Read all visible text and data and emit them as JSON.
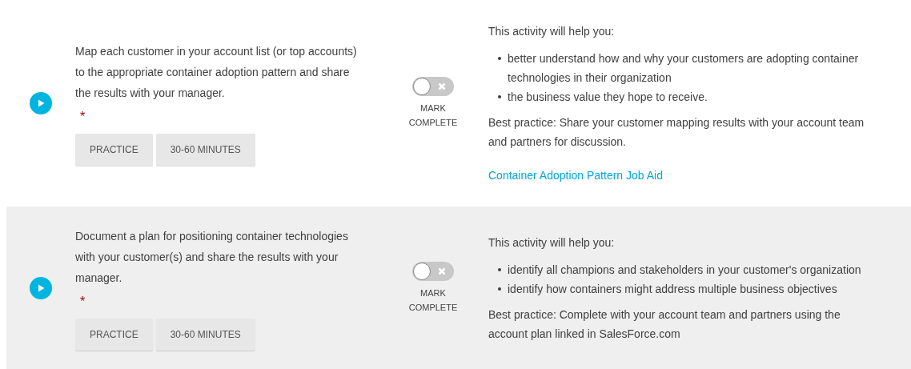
{
  "activities": [
    {
      "shaded": false,
      "description": "Map each customer in your account list (or top accounts) to the appropriate container adoption pattern and share the results with your manager.",
      "required_mark": "*",
      "tags": [
        "PRACTICE",
        "30-60 MINUTES"
      ],
      "toggle": {
        "checked": false,
        "label": "MARK COMPLETE"
      },
      "intro": "This activity will help you:",
      "bullets": [
        "better understand how and why your customers are adopting container technologies in their organization",
        "the business value they hope to receive."
      ],
      "best_practice": "Best practice: Share your customer mapping results with your account team and partners for discussion.",
      "link": "Container Adoption Pattern Job Aid"
    },
    {
      "shaded": true,
      "description": "Document a plan for positioning container technologies with your customer(s) and share the results with your manager.",
      "required_mark": "*",
      "tags": [
        "PRACTICE",
        "30-60 MINUTES"
      ],
      "toggle": {
        "checked": false,
        "label": "MARK COMPLETE"
      },
      "intro": "This activity will help you:",
      "bullets": [
        "identify all champions and stakeholders in your customer's organization",
        "identify how containers might address multiple business objectives"
      ],
      "best_practice": "Best practice: Complete with your account team and partners using the account plan linked in SalesForce.com"
    }
  ]
}
